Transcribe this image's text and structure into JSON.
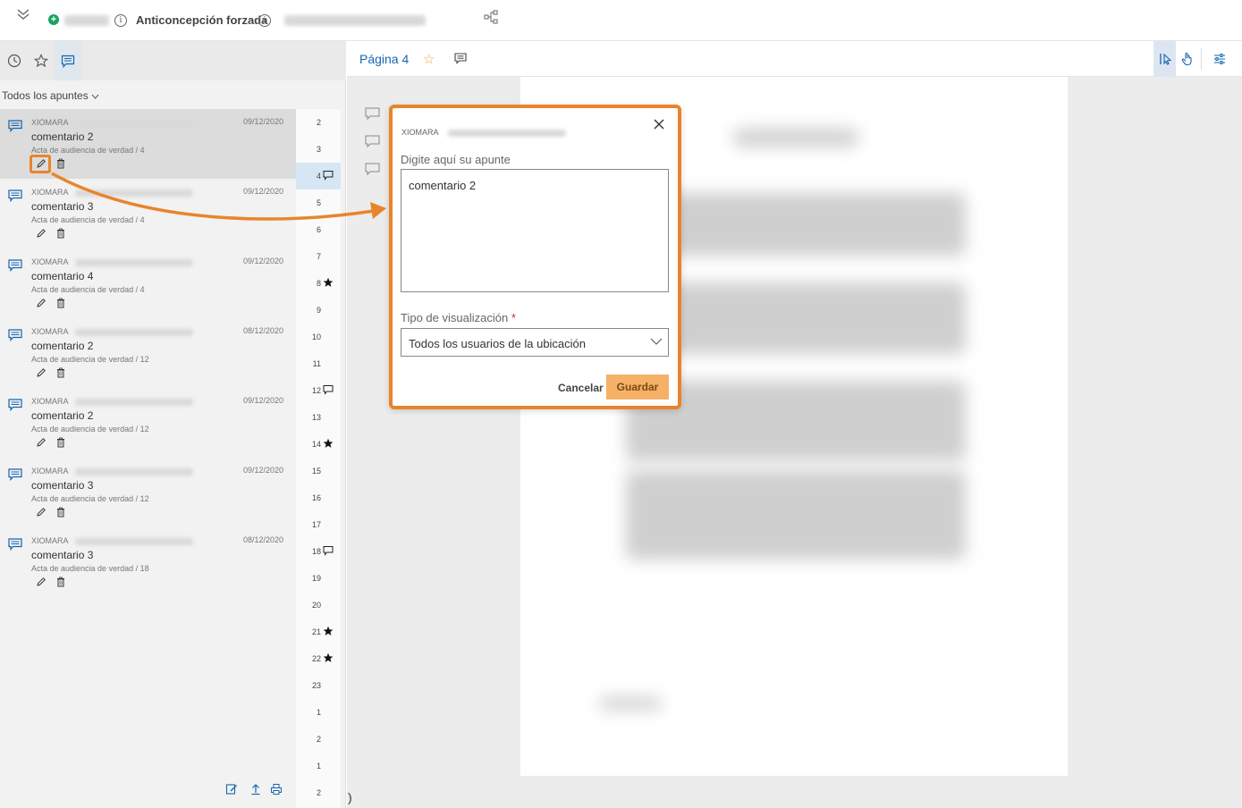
{
  "header": {
    "title": "Anticoncepción forzada"
  },
  "sidebar": {
    "filter_label": "Todos los apuntes",
    "notes": [
      {
        "author": "XIOMARA",
        "date": "09/12/2020",
        "text": "comentario 2",
        "doc": "Acta de audiencia de verdad / 4",
        "selected": true
      },
      {
        "author": "XIOMARA",
        "date": "09/12/2020",
        "text": "comentario 3",
        "doc": "Acta de audiencia de verdad / 4"
      },
      {
        "author": "XIOMARA",
        "date": "09/12/2020",
        "text": "comentario 4",
        "doc": "Acta de audiencia de verdad / 4"
      },
      {
        "author": "XIOMARA",
        "date": "08/12/2020",
        "text": "comentario 2",
        "doc": "Acta de audiencia de verdad / 12"
      },
      {
        "author": "XIOMARA",
        "date": "09/12/2020",
        "text": "comentario 2",
        "doc": "Acta de audiencia de verdad / 12"
      },
      {
        "author": "XIOMARA",
        "date": "09/12/2020",
        "text": "comentario 3",
        "doc": "Acta de audiencia de verdad / 12"
      },
      {
        "author": "XIOMARA",
        "date": "08/12/2020",
        "text": "comentario 3",
        "doc": "Acta de audiencia de verdad / 18"
      }
    ],
    "pages": [
      {
        "n": "2"
      },
      {
        "n": "3"
      },
      {
        "n": "4",
        "mark": "comment",
        "active": true
      },
      {
        "n": "5"
      },
      {
        "n": "6"
      },
      {
        "n": "7"
      },
      {
        "n": "8",
        "mark": "star"
      },
      {
        "n": "9"
      },
      {
        "n": "10"
      },
      {
        "n": "11"
      },
      {
        "n": "12",
        "mark": "comment"
      },
      {
        "n": "13"
      },
      {
        "n": "14",
        "mark": "star"
      },
      {
        "n": "15"
      },
      {
        "n": "16"
      },
      {
        "n": "17"
      },
      {
        "n": "18",
        "mark": "comment"
      },
      {
        "n": "19"
      },
      {
        "n": "20"
      },
      {
        "n": "21",
        "mark": "star"
      },
      {
        "n": "22",
        "mark": "star"
      },
      {
        "n": "23"
      },
      {
        "n": "1"
      },
      {
        "n": "2"
      },
      {
        "n": "1"
      },
      {
        "n": "2"
      }
    ]
  },
  "viewer": {
    "page_label": "Página 4",
    "paren": ")"
  },
  "popup": {
    "author": "XIOMARA",
    "note_label": "Digite aquí su apunte",
    "note_value": "comentario 2",
    "visibility_label": "Tipo de visualización",
    "required_mark": "*",
    "visibility_value": "Todos los usuarios de la ubicación",
    "cancel_label": "Cancelar",
    "save_label": "Guardar"
  },
  "colors": {
    "accent": "#1565b0",
    "highlight": "#e8852a",
    "save_button": "#f5b167",
    "star": "#f0a832"
  }
}
